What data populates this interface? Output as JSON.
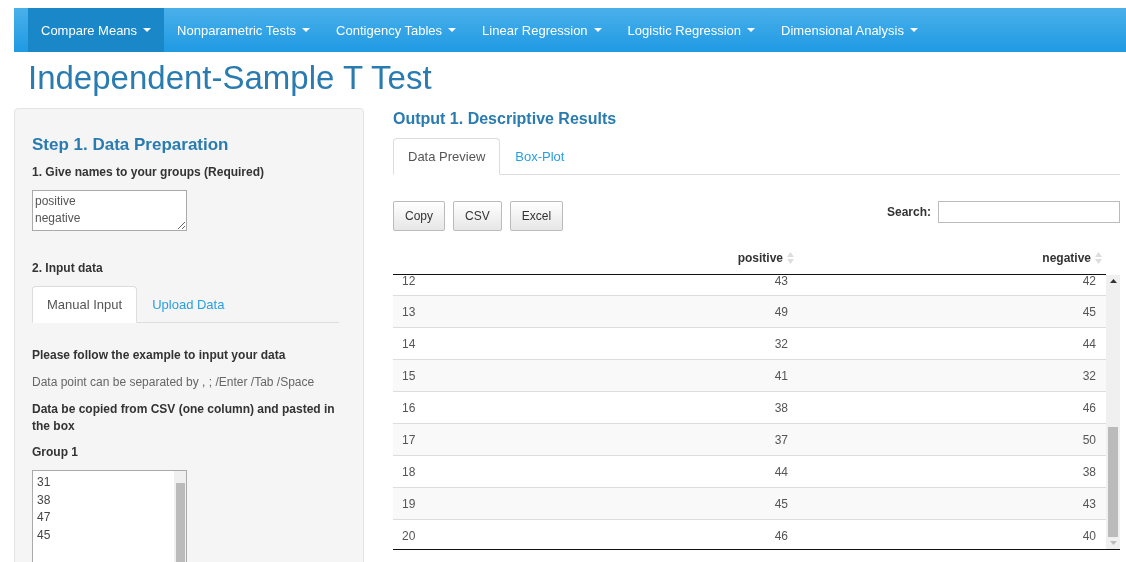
{
  "navbar": {
    "items": [
      {
        "label": "Compare Means",
        "selected": true
      },
      {
        "label": "Nonparametric Tests",
        "selected": false
      },
      {
        "label": "Contigency Tables",
        "selected": false
      },
      {
        "label": "Linear Regression",
        "selected": false
      },
      {
        "label": "Logistic Regression",
        "selected": false
      },
      {
        "label": "Dimensional Analysis",
        "selected": false
      }
    ]
  },
  "page_title": "Independent-Sample T Test",
  "sidebar": {
    "title": "Step 1. Data Preparation",
    "names_label": "1. Give names to your groups (Required)",
    "names_value": "positive\nnegative",
    "input_label": "2. Input data",
    "tabs": [
      {
        "label": "Manual Input",
        "selected": true
      },
      {
        "label": "Upload Data",
        "selected": false
      }
    ],
    "instructions": [
      {
        "text": "Please follow the example to input your data",
        "bold": true
      },
      {
        "text": "Data point can be separated by , ; /Enter /Tab /Space",
        "bold": false
      },
      {
        "text": "Data be copied from CSV (one column) and pasted in the box",
        "bold": true
      }
    ],
    "group_label": "Group 1",
    "group_value": "31\n38\n47\n45"
  },
  "output": {
    "title": "Output 1. Descriptive Results",
    "tabs": [
      {
        "label": "Data Preview",
        "selected": true
      },
      {
        "label": "Box-Plot",
        "selected": false
      }
    ],
    "buttons": [
      "Copy",
      "CSV",
      "Excel"
    ],
    "search_label": "Search:",
    "table": {
      "columns": [
        "",
        "positive",
        "negative"
      ],
      "rows": [
        [
          "12",
          "43",
          "42"
        ],
        [
          "13",
          "49",
          "45"
        ],
        [
          "14",
          "32",
          "44"
        ],
        [
          "15",
          "41",
          "32"
        ],
        [
          "16",
          "38",
          "46"
        ],
        [
          "17",
          "37",
          "50"
        ],
        [
          "18",
          "44",
          "38"
        ],
        [
          "19",
          "45",
          "43"
        ],
        [
          "20",
          "46",
          "40"
        ]
      ]
    }
  }
}
